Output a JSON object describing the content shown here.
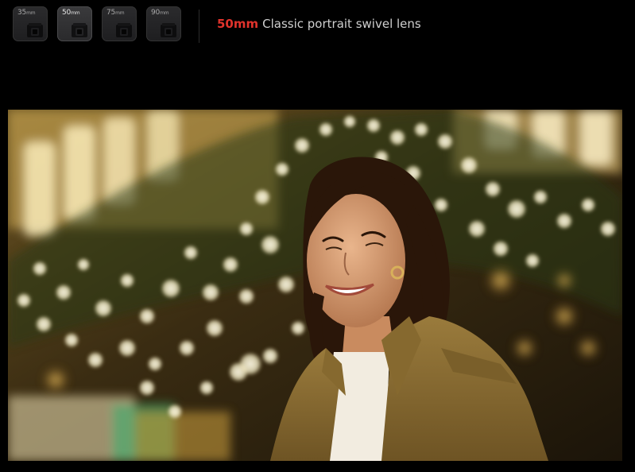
{
  "lens_selector": {
    "items": [
      {
        "value": "35",
        "unit": "mm"
      },
      {
        "value": "50",
        "unit": "mm"
      },
      {
        "value": "75",
        "unit": "mm"
      },
      {
        "value": "90",
        "unit": "mm"
      }
    ],
    "selected_index": 1
  },
  "header": {
    "focal_length": "50mm",
    "description": "Classic portrait swivel lens"
  },
  "colors": {
    "accent": "#e0332c",
    "background": "#000000",
    "description_text": "#cfcfcf"
  },
  "icons": {
    "lens_thumb": "camera-lens-icon"
  }
}
